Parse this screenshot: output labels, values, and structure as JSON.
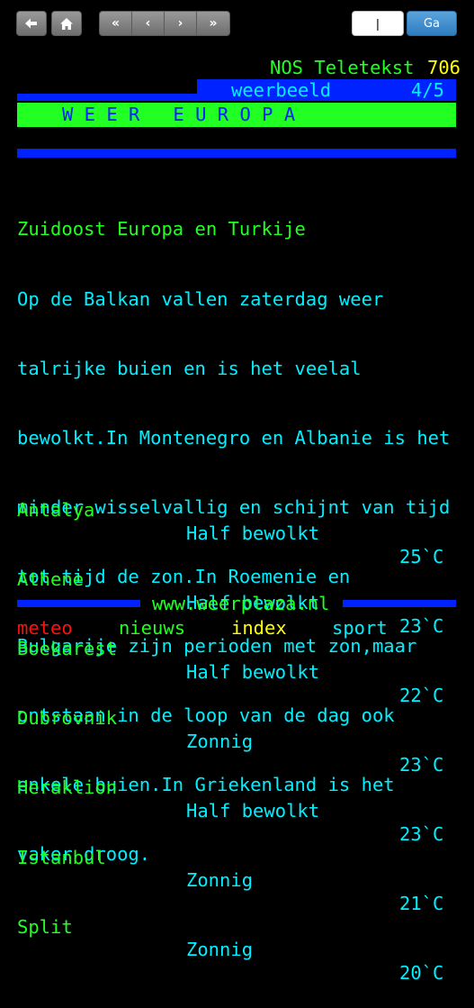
{
  "toolbar": {
    "page_input_value": "|",
    "go_label": "Ga",
    "nav_first": "«",
    "nav_prev": "‹",
    "nav_next": "›",
    "nav_last": "»"
  },
  "header": {
    "service": "NOS Teletekst",
    "page": "706"
  },
  "subtitle": {
    "label": "weerbeeld",
    "count": "4/5"
  },
  "title": "W E E R   E U R O P A",
  "article": {
    "heading": "Zuidoost Europa en Turkije",
    "lines": [
      "Op de Balkan vallen zaterdag weer",
      "talrijke buien en is het veelal",
      "bewolkt.In Montenegro en Albanie is het",
      "minder wisselvallig en schijnt van tijd",
      "tot tijd de zon.In Roemenie en",
      "Bulgarije zijn perioden met zon,maar",
      "ontstaan in de loop van de dag ook",
      "enkele buien.In Griekenland is het",
      "vaker droog."
    ]
  },
  "weather": [
    {
      "city": "Antalya",
      "condition": "Half bewolkt",
      "temp": "25`C"
    },
    {
      "city": "Athene",
      "condition": "Half bewolkt",
      "temp": "23`C"
    },
    {
      "city": "Boekarest",
      "condition": "Half bewolkt",
      "temp": "22`C"
    },
    {
      "city": "Dubrovnik",
      "condition": "Zonnig",
      "temp": "23`C"
    },
    {
      "city": "Heraklion",
      "condition": "Half bewolkt",
      "temp": "23`C"
    },
    {
      "city": "Istanbul",
      "condition": "Zonnig",
      "temp": "21`C"
    },
    {
      "city": "Split",
      "condition": "Zonnig",
      "temp": "20`C"
    }
  ],
  "footer": {
    "url": "www.weerplaza.nl"
  },
  "fastext": {
    "red": "meteo",
    "green": "nieuws",
    "yellow": "index",
    "cyan": "sport"
  },
  "colors": {
    "background": "#000000",
    "teletext_cyan": "#00f0ff",
    "teletext_green": "#22ff22",
    "teletext_yellow": "#ffff00",
    "teletext_red": "#ff1010",
    "teletext_blue": "#0022ff",
    "go_button": "#3a8ad0"
  },
  "icons": {
    "back": "arrow-left-icon",
    "home": "home-icon"
  }
}
